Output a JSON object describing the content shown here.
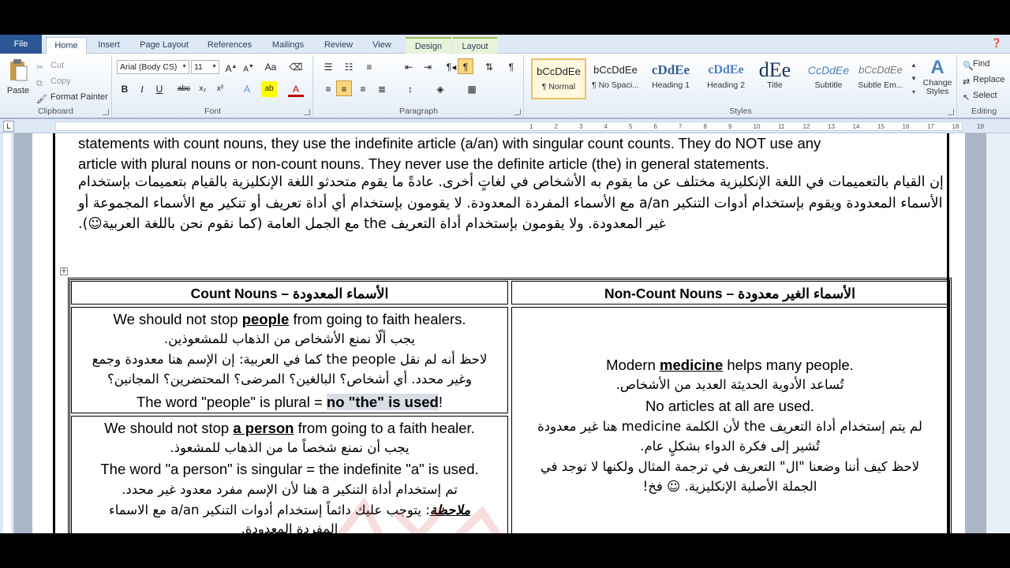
{
  "tabs": {
    "file": "File",
    "home": "Home",
    "insert": "Insert",
    "page_layout": "Page Layout",
    "references": "References",
    "mailings": "Mailings",
    "review": "Review",
    "view": "View",
    "design": "Design",
    "layout": "Layout"
  },
  "clipboard": {
    "paste": "Paste",
    "cut": "Cut",
    "copy": "Copy",
    "format_painter": "Format Painter",
    "label": "Clipboard"
  },
  "font": {
    "name": "Arial (Body CS)",
    "size": "11",
    "label": "Font"
  },
  "paragraph": {
    "label": "Paragraph"
  },
  "styles": {
    "label": "Styles",
    "items": [
      {
        "sample": "bCcDdEe",
        "name": "¶ Normal"
      },
      {
        "sample": "bCcDdEe",
        "name": "¶ No Spaci..."
      },
      {
        "sample": "cDdEe",
        "name": "Heading 1"
      },
      {
        "sample": "cDdEe",
        "name": "Heading 2"
      },
      {
        "sample": "dEe",
        "name": "Title"
      },
      {
        "sample": "CcDdEe",
        "name": "Subtitle"
      },
      {
        "sample": "bCcDdEe",
        "name": "Subtle Em..."
      }
    ],
    "change": "Change Styles"
  },
  "editing": {
    "find": "Find",
    "replace": "Replace",
    "select": "Select",
    "label": "Editing"
  },
  "ruler": {
    "numbers": [
      "1",
      "2",
      "3",
      "4",
      "5",
      "6",
      "7",
      "8",
      "9",
      "10",
      "11",
      "12",
      "13",
      "14",
      "15",
      "16",
      "17",
      "18",
      "19"
    ]
  },
  "doc": {
    "line1": "statements with count nouns, they use the indefinite article (a/an) with singular count counts. They do NOT use any",
    "line2": "article with plural nouns or non-count nouns. They never use the definite article (the) in general statements.",
    "ar1": "إن القيام بالتعميمات في اللغة الإنكليزية مختلف عن ما يقوم به الأشخاص في لغاتٍ أخرى. عادةً ما يقوم متحدثو اللغة الإنكليزية بالقيام بتعميمات بإستخدام",
    "ar2": "الأسماء المعدودة ويقوم بإستخدام أدوات التنكير a/an مع الأسماء المفردة المعدودة. لا يقومون بإستخدام أي أداة تعريف أو تنكير مع الأسماء المجموعة أو",
    "ar3": "غير المعدودة. ولا يقومون بإستخدام أداة التعريف the مع الجمل العامة (كما نقوم نحن باللغة العربية☺).",
    "table": {
      "h_noncount": "Non-Count Nouns – الأسماء الغير معدودة",
      "h_count": "Count Nouns – الأسماء المعدودة",
      "c1_pre": "We should not stop ",
      "c1_word": "people",
      "c1_post": " from going to faith healers.",
      "c1_ar1": "يجب ألّا نمنع الأشخاص من الذهاب للمشعوذين.",
      "c1_ar2": "لاحظ أنه لم نقل the people كما في العربية: إن الإسم هنا معدودة وجمع",
      "c1_ar3": "وغير محدد. أي أشخاص؟ البالغين؟ المرضى؟ المحتضرين؟ المجانين؟",
      "c1_note_pre": "The word \"people\" is plural = ",
      "c1_note_hl": "no \"the\" is used",
      "c1_note_post": "!",
      "c2_pre": "We should not stop ",
      "c2_word": "a person",
      "c2_post": " from going to a faith healer.",
      "c2_ar1": "يجب أن نمنع شخصاً ما من الذهاب للمشعوذ.",
      "c2_note": "The word \"a person\" is singular = the indefinite \"a\" is used.",
      "c2_ar2": "تم إستخدام أداة التنكير a هنا لأن الإسم مفرد معدود غير محدد.",
      "c2_ar3_word": "ملاحظة",
      "c2_ar3": ": يتوجب عليك دائماً إستخدام أدوات التنكير a/an مع الاسماء",
      "c2_ar4": "المفردة المعدودة.",
      "n1_pre": "Modern ",
      "n1_word": "medicine",
      "n1_post": " helps many people.",
      "n1_ar1": "تُساعد الأدوية الحديثة العديد من الأشخاص.",
      "n1_note": "No articles at all are used.",
      "n1_ar2": "لم يتم إستخدام أداة التعريف the لأن الكلمة medicine هنا غير معدودة",
      "n1_ar3": "تُشير إلى فكرة الدواء بشكلٍ عام.",
      "n1_ar4": "لاحظ كيف أننا وضعنا \"ال\" التعريف في ترجمة المثال ولكنها لا توجد في",
      "n1_ar5": "الجملة الأصلية الإنكليزية. ☺ فخ!"
    }
  }
}
